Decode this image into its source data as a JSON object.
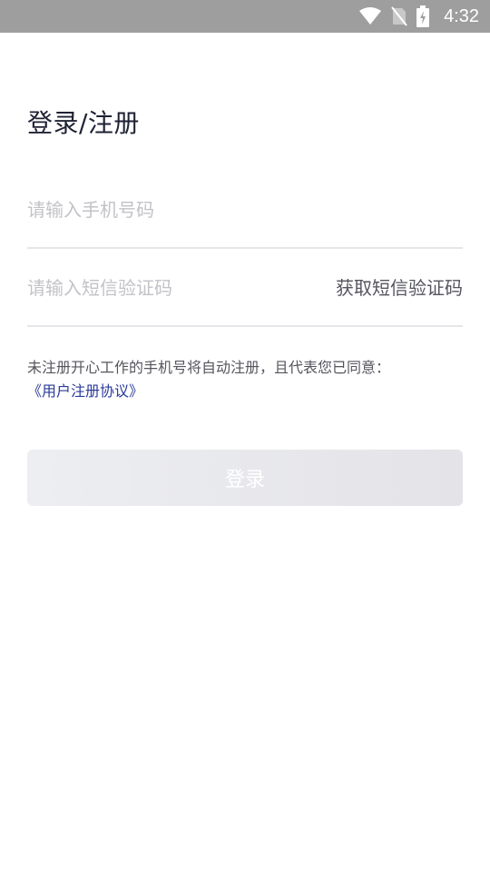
{
  "status_bar": {
    "time": "4:32",
    "icons": [
      "wifi-icon",
      "no-sim-icon",
      "battery-charging-icon"
    ]
  },
  "page": {
    "title": "登录/注册"
  },
  "form": {
    "phone_placeholder": "请输入手机号码",
    "phone_value": "",
    "code_placeholder": "请输入短信验证码",
    "code_value": "",
    "get_code_label": "获取短信验证码",
    "notice_text": "未注册开心工作的手机号将自动注册，且代表您已同意：",
    "agreement_link": "《用户注册协议》",
    "login_label": "登录"
  },
  "colors": {
    "status_bar_bg": "#9e9e9e",
    "title": "#1f2233",
    "placeholder": "#c2c2c8",
    "link": "#2a3a9a",
    "button_disabled": "#e8e9ed"
  }
}
